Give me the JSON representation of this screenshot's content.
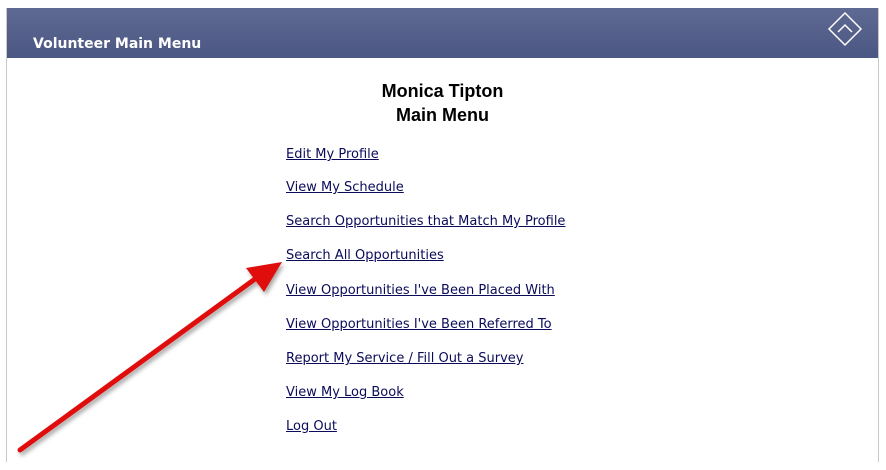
{
  "header": {
    "title": "Volunteer Main Menu",
    "icon": "diamond-chevron-icon"
  },
  "main": {
    "volunteer_name": "Monica Tipton",
    "subtitle": "Main Menu",
    "links": [
      "Edit My Profile",
      "View My Schedule",
      "Search Opportunities that Match My Profile",
      "Search All Opportunities",
      "View Opportunities I've Been Placed With",
      "View Opportunities I've Been Referred To",
      "Report My Service / Fill Out a Survey",
      "View My Log Book",
      "Log Out"
    ]
  },
  "annotation": {
    "type": "red-arrow",
    "points_to": "Search All Opportunities",
    "color": "#e01010"
  },
  "colors": {
    "header_bg": "#56628c",
    "link": "#0b0b5a"
  }
}
